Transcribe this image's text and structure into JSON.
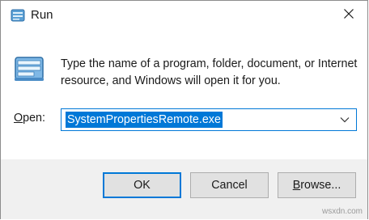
{
  "window": {
    "title": "Run",
    "title_icon": "run-app-icon",
    "close_icon": "close-icon"
  },
  "content": {
    "icon": "run-dialog-icon",
    "description": "Type the name of a program, folder, document, or Internet resource, and Windows will open it for you.",
    "open_label": "Open:",
    "open_value": "SystemPropertiesRemote.exe",
    "dropdown_icon": "chevron-down-icon"
  },
  "buttons": {
    "ok": "OK",
    "cancel": "Cancel",
    "browse": "Browse..."
  },
  "watermark": "wsxdn.com",
  "colors": {
    "accent": "#0078d7",
    "footer_bg": "#f0f0f0",
    "button_bg": "#e1e1e1"
  }
}
